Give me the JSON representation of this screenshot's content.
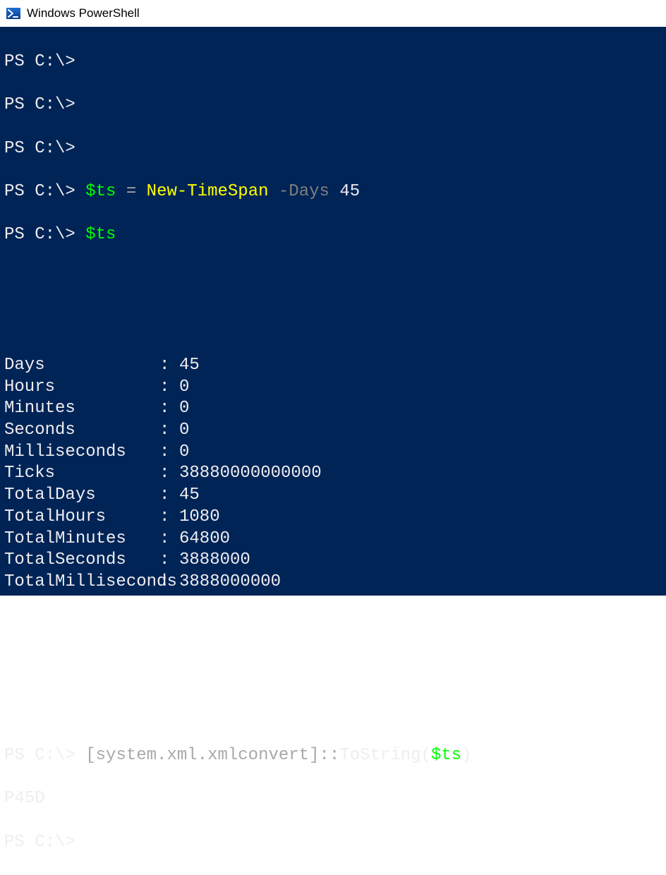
{
  "window": {
    "title": "Windows PowerShell"
  },
  "prompt": "PS C:\\>",
  "lines": {
    "blank1": "",
    "cmd1_var": "$ts",
    "cmd1_eq": " = ",
    "cmd1_cmd": "New-TimeSpan",
    "cmd1_param": " -Days",
    "cmd1_val": " 45",
    "cmd2_var": "$ts",
    "cmd3_class": "[system.xml.xmlconvert]",
    "cmd3_op": "::",
    "cmd3_method": "ToString(",
    "cmd3_arg": "$ts",
    "cmd3_close": ")",
    "result3": "P45D"
  },
  "output": {
    "rows": [
      {
        "key": "Days",
        "val": "45"
      },
      {
        "key": "Hours",
        "val": "0"
      },
      {
        "key": "Minutes",
        "val": "0"
      },
      {
        "key": "Seconds",
        "val": "0"
      },
      {
        "key": "Milliseconds",
        "val": "0"
      },
      {
        "key": "Ticks",
        "val": "38880000000000"
      },
      {
        "key": "TotalDays",
        "val": "45"
      },
      {
        "key": "TotalHours",
        "val": "1080"
      },
      {
        "key": "TotalMinutes",
        "val": "64800"
      },
      {
        "key": "TotalSeconds",
        "val": "3888000"
      },
      {
        "key": "TotalMilliseconds",
        "val": "3888000000"
      }
    ]
  }
}
